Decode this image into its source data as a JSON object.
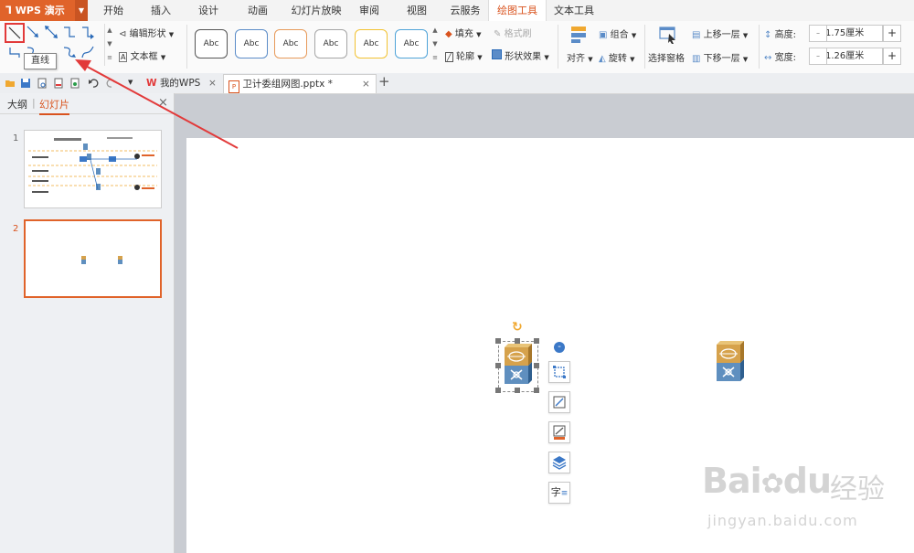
{
  "app": {
    "name": "WPS 演示"
  },
  "menu": {
    "tabs": [
      {
        "label": "开始"
      },
      {
        "label": "插入"
      },
      {
        "label": "设计"
      },
      {
        "label": "动画"
      },
      {
        "label": "幻灯片放映"
      },
      {
        "label": "审阅"
      },
      {
        "label": "视图"
      },
      {
        "label": "云服务"
      },
      {
        "label": "绘图工具"
      },
      {
        "label": "文本工具"
      }
    ],
    "active": "绘图工具"
  },
  "ribbon": {
    "edit_shape": "编辑形状",
    "textbox": "文本框",
    "style_sample": "Abc",
    "fill": "填充",
    "format_brush": "格式刷",
    "outline": "轮廓",
    "shape_effect": "形状效果",
    "align": "对齐",
    "group": "组合",
    "rotate": "旋转",
    "select_pane": "选择窗格",
    "bring_forward": "上移一层",
    "send_backward": "下移一层",
    "height_label": "高度:",
    "height_value": "1.75厘米",
    "width_label": "宽度:",
    "width_value": "1.26厘米",
    "plus": "+",
    "minus": "-"
  },
  "tooltip": "直线",
  "doc_tabs": [
    {
      "label": "我的WPS",
      "close": "×"
    },
    {
      "label": "卫计委组网图.pptx *",
      "close": "×"
    }
  ],
  "add_tab": "+",
  "panel": {
    "tabs": [
      {
        "label": "大纲"
      },
      {
        "label": "幻灯片"
      }
    ],
    "separator": "|",
    "close": "×",
    "slides": [
      {
        "number": "1"
      },
      {
        "number": "2"
      }
    ]
  },
  "float_toolbar": {
    "text_icon": "字"
  },
  "watermark": {
    "brand": "Bai",
    "brand_suffix": "du",
    "chinese": "经验",
    "url": "jingyan.baidu.com"
  },
  "colors": {
    "accent": "#e0632a",
    "active_tab_text": "#d9531e",
    "highlight_red": "#e23a3a",
    "switch_top": "#d6a24c",
    "switch_bottom": "#5f8fbf"
  }
}
